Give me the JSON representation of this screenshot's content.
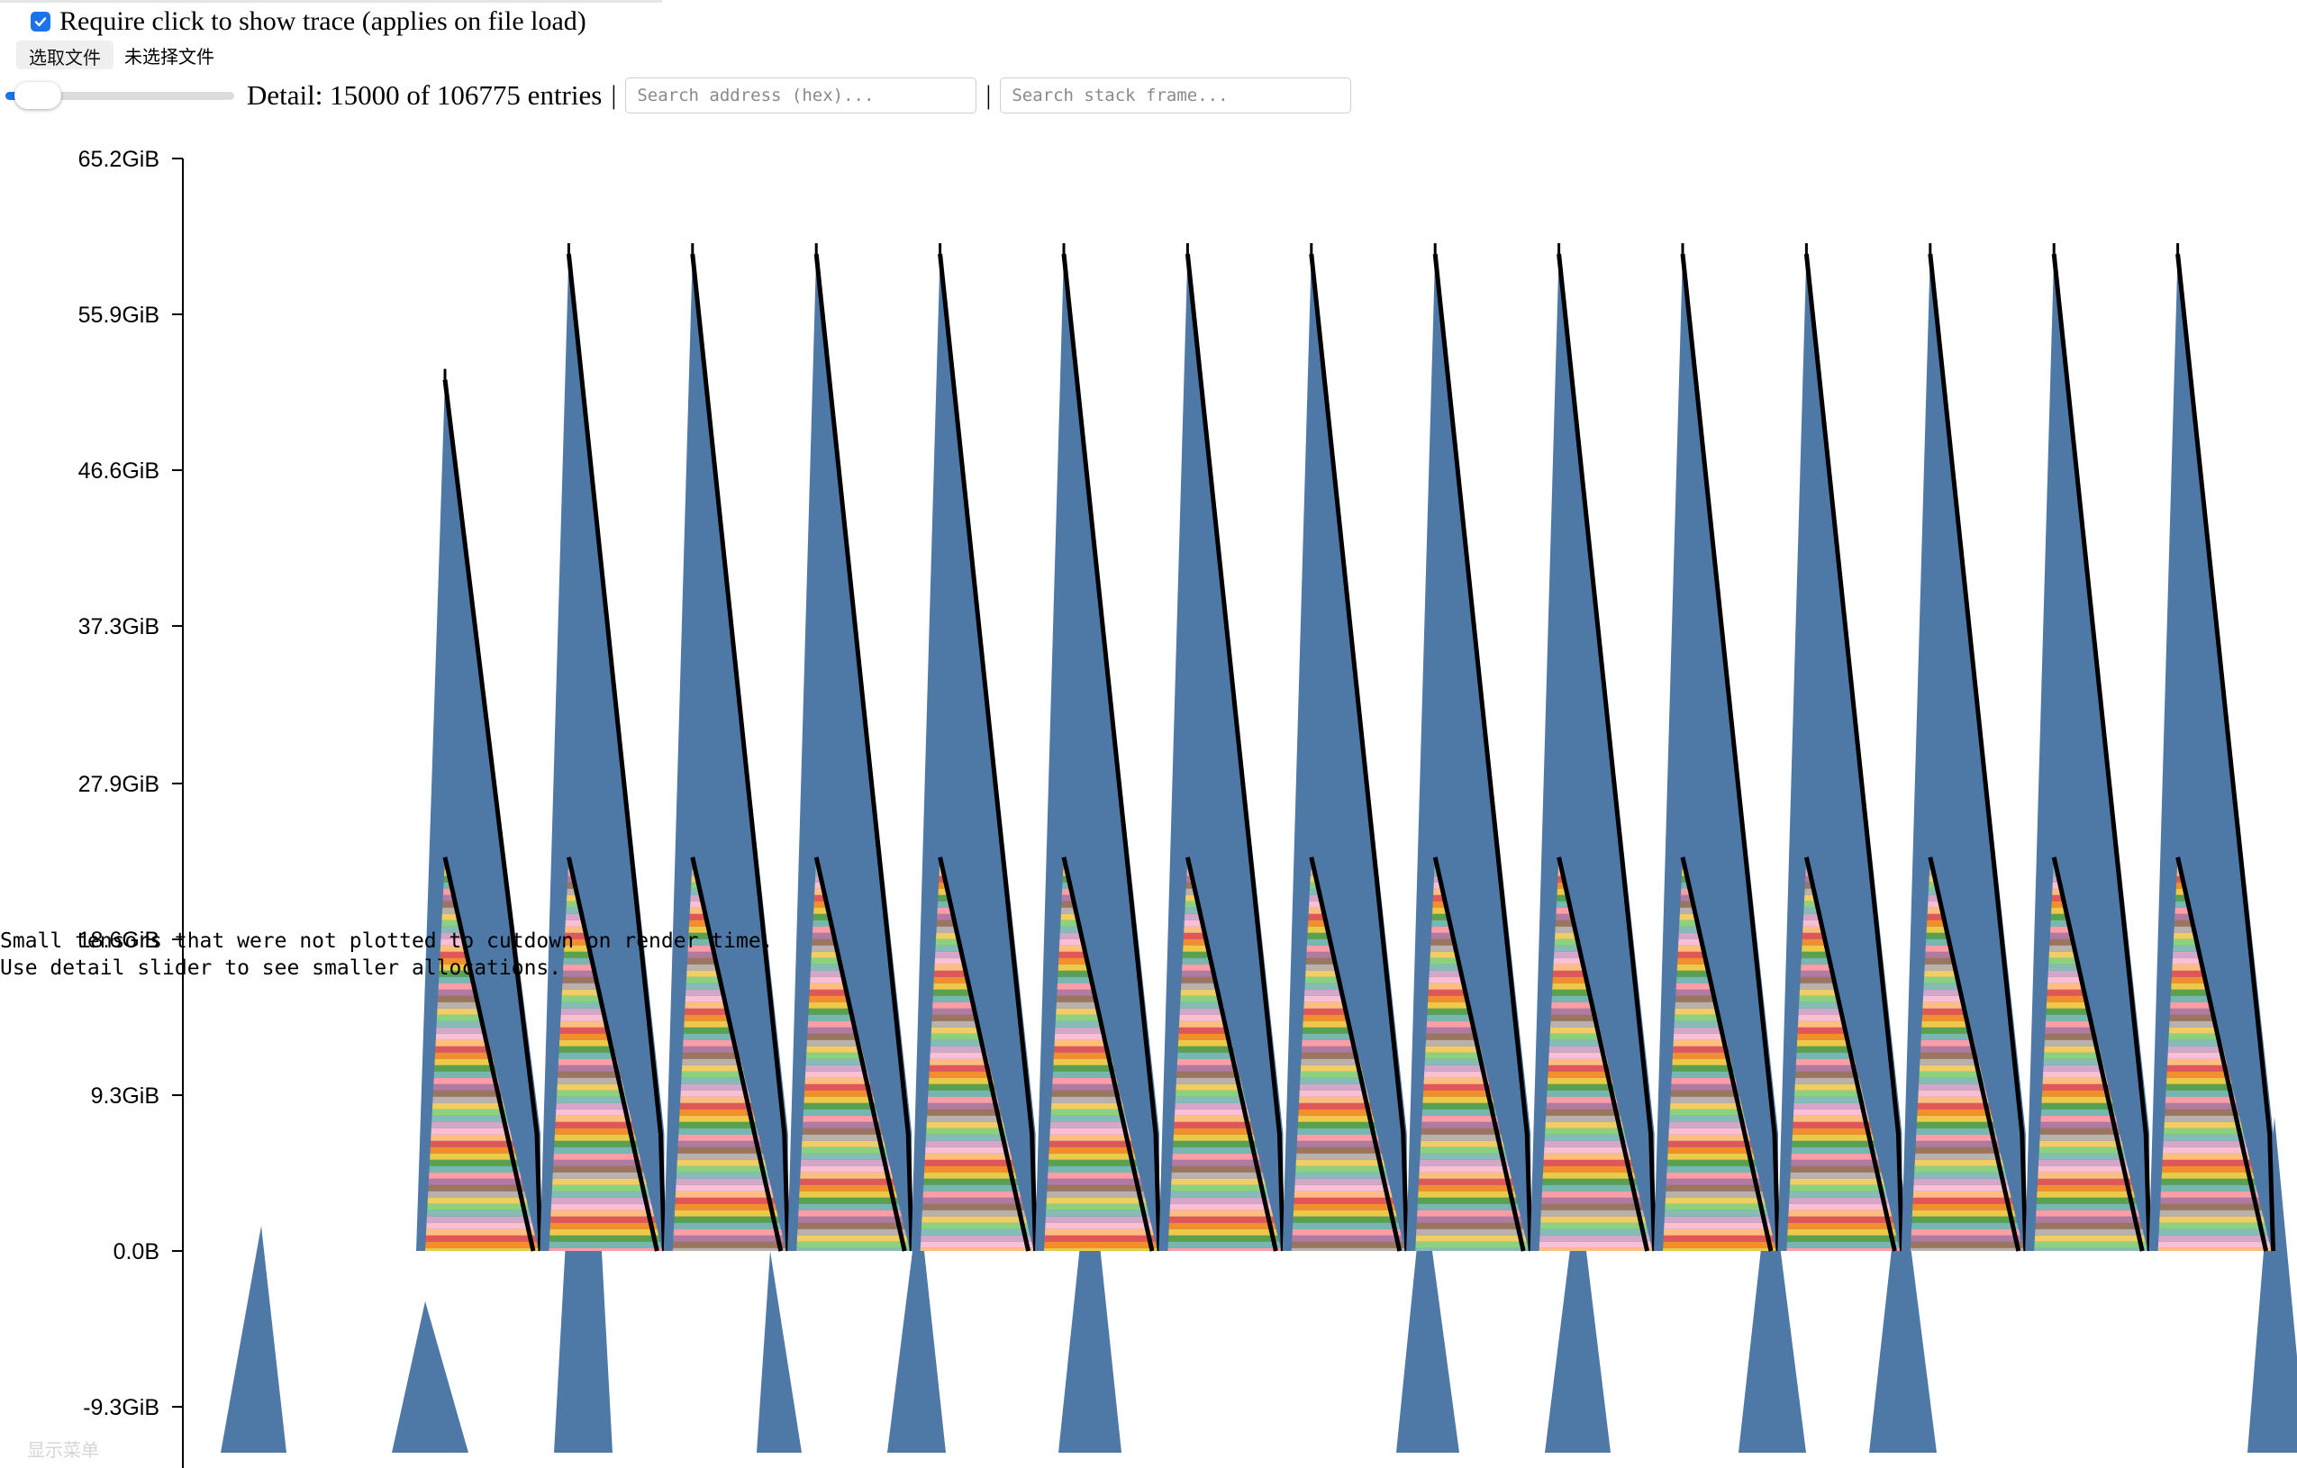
{
  "controls": {
    "trace_checkbox_label": "Require click to show trace (applies on file load)",
    "trace_checked": true,
    "file_button_label": "选取文件",
    "file_status": "未选择文件",
    "detail_slider_value": 0.05,
    "detail_text": "Detail: 15000 of 106775 entries",
    "separator": "|",
    "search_address_placeholder": "Search address (hex)...",
    "search_frame_placeholder": "Search stack frame..."
  },
  "notice": {
    "line1": "Small tensors that were not plotted to cutdown on render time.",
    "line2": "Use detail slider to see smaller allocations."
  },
  "menu_hint": "显示菜单",
  "colors": {
    "accent": "#1a73e8",
    "large_alloc": "#4e79a7",
    "stripe_palette": [
      "#e15759",
      "#f28e2b",
      "#edc948",
      "#59a14f",
      "#76b7b2",
      "#ff9da7",
      "#b07aa1",
      "#9c755f",
      "#bab0ac",
      "#f1ce63",
      "#8cd17d",
      "#86bcb6",
      "#d4a6c8",
      "#fabfd2",
      "#ffbe7d"
    ]
  },
  "chart_data": {
    "type": "area",
    "y_unit": "GiB",
    "y_ticks": [
      65.2,
      55.9,
      46.6,
      37.3,
      27.9,
      18.6,
      9.3,
      0.0,
      -9.3
    ],
    "y_tick_labels": [
      "65.2GiB",
      "55.9GiB",
      "46.6GiB",
      "37.3GiB",
      "27.9GiB",
      "18.6GiB",
      "9.3GiB",
      "0.0B",
      "-9.3GiB"
    ],
    "ylim": [
      -11.5,
      65.2
    ],
    "cycles": 15,
    "first_cycle_peak": 52.0,
    "cycle_peak": 59.5,
    "cycle_trough": 7.0,
    "small_alloc_peak": 23.5,
    "grid": false
  }
}
